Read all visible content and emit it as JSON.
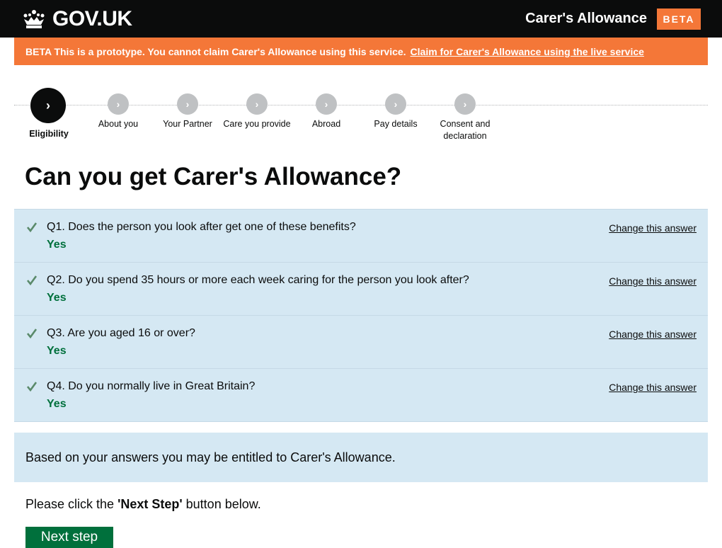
{
  "header": {
    "logo_text": "GOV.UK",
    "logo_icon": "crown-icon",
    "service_name": "Carer's Allowance",
    "phase_tag": "BETA"
  },
  "banner": {
    "text": "BETA This is a prototype. You cannot claim Carer's Allowance using this service.",
    "link_text": "Claim for Carer's Allowance using the live service"
  },
  "progress": {
    "steps": [
      {
        "label": "Eligibility",
        "current": true
      },
      {
        "label": "About you",
        "current": false
      },
      {
        "label": "Your Partner",
        "current": false
      },
      {
        "label": "Care you provide",
        "current": false
      },
      {
        "label": "Abroad",
        "current": false
      },
      {
        "label": "Pay details",
        "current": false
      },
      {
        "label": "Consent and declaration",
        "current": false
      }
    ],
    "step_icon": "chevron-right-icon"
  },
  "page": {
    "title": "Can you get Carer's Allowance?"
  },
  "questions": [
    {
      "question": "Q1. Does the person you look after get one of these benefits?",
      "answer": "Yes",
      "change_label": "Change this answer"
    },
    {
      "question": "Q2. Do you spend 35 hours or more each week caring for the person you look after?",
      "answer": "Yes",
      "change_label": "Change this answer"
    },
    {
      "question": "Q3. Are you aged 16 or over?",
      "answer": "Yes",
      "change_label": "Change this answer"
    },
    {
      "question": "Q4. Do you normally live in Great Britain?",
      "answer": "Yes",
      "change_label": "Change this answer"
    }
  ],
  "result": {
    "text": "Based on your answers you may be entitled to Carer's Allowance."
  },
  "instruction": {
    "before": "Please click the ",
    "emphasis": "'Next Step'",
    "after": " button below."
  },
  "actions": {
    "next_label": "Next step"
  },
  "colors": {
    "header_bg": "#0b0c0c",
    "beta_orange": "#f47738",
    "panel_blue": "#d5e8f3",
    "answer_green": "#00703c",
    "button_green": "#00703c"
  }
}
